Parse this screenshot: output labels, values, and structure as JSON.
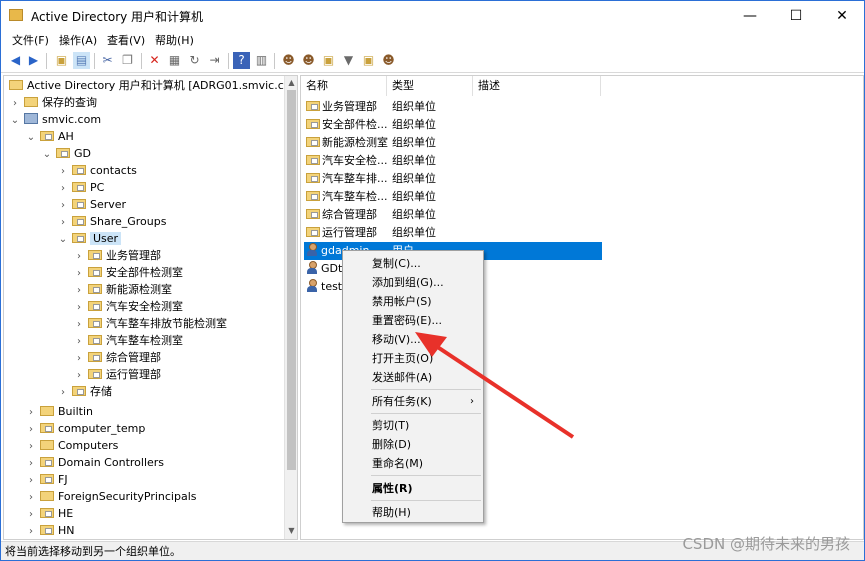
{
  "window": {
    "title": "Active Directory 用户和计算机",
    "minimize": "—",
    "maximize": "☐",
    "close": "✕"
  },
  "menu": [
    "文件(F)",
    "操作(A)",
    "查看(V)",
    "帮助(H)"
  ],
  "tree": {
    "root": "Active Directory 用户和计算机 [ADRG01.smvic.com]",
    "saved_queries": "保存的查询",
    "domain": "smvic.com",
    "ah": "AH",
    "gd": "GD",
    "gd_children": [
      "contacts",
      "PC",
      "Server",
      "Share_Groups",
      "User"
    ],
    "user_children": [
      "业务管理部",
      "安全部件检测室",
      "新能源检测室",
      "汽车安全检测室",
      "汽车整车排放节能检测室",
      "汽车整车检测室",
      "综合管理部",
      "运行管理部"
    ],
    "storage": "存储",
    "top_level": [
      "Builtin",
      "computer_temp",
      "Computers",
      "Domain Controllers",
      "FJ",
      "ForeignSecurityPrincipals",
      "HE",
      "HN"
    ]
  },
  "list": {
    "columns": [
      "名称",
      "类型",
      "描述"
    ],
    "rows": [
      {
        "name": "业务管理部",
        "type": "组织单位",
        "icon": "ou-folder-icon"
      },
      {
        "name": "安全部件检...",
        "type": "组织单位",
        "icon": "ou-folder-icon"
      },
      {
        "name": "新能源检测室",
        "type": "组织单位",
        "icon": "ou-folder-icon"
      },
      {
        "name": "汽车安全检...",
        "type": "组织单位",
        "icon": "ou-folder-icon"
      },
      {
        "name": "汽车整车排...",
        "type": "组织单位",
        "icon": "ou-folder-icon"
      },
      {
        "name": "汽车整车检...",
        "type": "组织单位",
        "icon": "ou-folder-icon"
      },
      {
        "name": "综合管理部",
        "type": "组织单位",
        "icon": "ou-folder-icon"
      },
      {
        "name": "运行管理部",
        "type": "组织单位",
        "icon": "ou-folder-icon"
      },
      {
        "name": "gdadmin",
        "type": "用户",
        "icon": "user-icon"
      },
      {
        "name": "GDte",
        "type": "",
        "icon": "group-icon"
      },
      {
        "name": "test0",
        "type": "",
        "icon": "user-icon"
      }
    ]
  },
  "context_menu": {
    "items": [
      "复制(C)...",
      "添加到组(G)...",
      "禁用帐户(S)",
      "重置密码(E)...",
      "移动(V)...",
      "打开主页(O)",
      "发送邮件(A)",
      "所有任务(K)",
      "剪切(T)",
      "删除(D)",
      "重命名(M)",
      "属性(R)",
      "帮助(H)"
    ]
  },
  "status_text": "将当前选择移动到另一个组织单位。",
  "watermark": "CSDN @期待未来的男孩",
  "colors": {
    "selection": "#0078d7",
    "arrow": "#e8312a",
    "tree_selection": "#cce4f7"
  }
}
